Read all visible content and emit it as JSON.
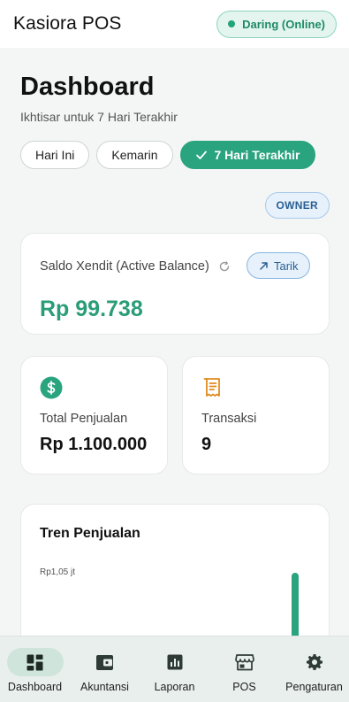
{
  "header": {
    "app_title": "Kasiora POS",
    "status_label": "Daring (Online)"
  },
  "dashboard": {
    "title": "Dashboard",
    "subtitle": "Ikhtisar untuk 7 Hari Terakhir",
    "filters": [
      {
        "label": "Hari Ini",
        "active": false
      },
      {
        "label": "Kemarin",
        "active": false
      },
      {
        "label": "7 Hari Terakhir",
        "active": true
      }
    ],
    "role_badge": "OWNER"
  },
  "balance": {
    "label": "Saldo Xendit (Active Balance)",
    "withdraw_label": "Tarik",
    "value": "Rp 99.738"
  },
  "stats": {
    "sales": {
      "label": "Total Penjualan",
      "value": "Rp 1.100.000",
      "icon": "dollar-circle-icon"
    },
    "transactions": {
      "label": "Transaksi",
      "value": "9",
      "icon": "receipt-icon"
    }
  },
  "trend": {
    "title": "Tren Penjualan",
    "top_tick_label": "Rp1,05 jt"
  },
  "bottom_nav": [
    {
      "label": "Dashboard",
      "icon": "dashboard-icon",
      "active": true
    },
    {
      "label": "Akuntansi",
      "icon": "wallet-icon",
      "active": false
    },
    {
      "label": "Laporan",
      "icon": "report-icon",
      "active": false
    },
    {
      "label": "POS",
      "icon": "store-icon",
      "active": false
    },
    {
      "label": "Pengaturan",
      "icon": "gear-icon",
      "active": false
    }
  ],
  "colors": {
    "accent": "#2aa37f",
    "balance_text": "#2a9d78",
    "info": "#2a5f93"
  }
}
